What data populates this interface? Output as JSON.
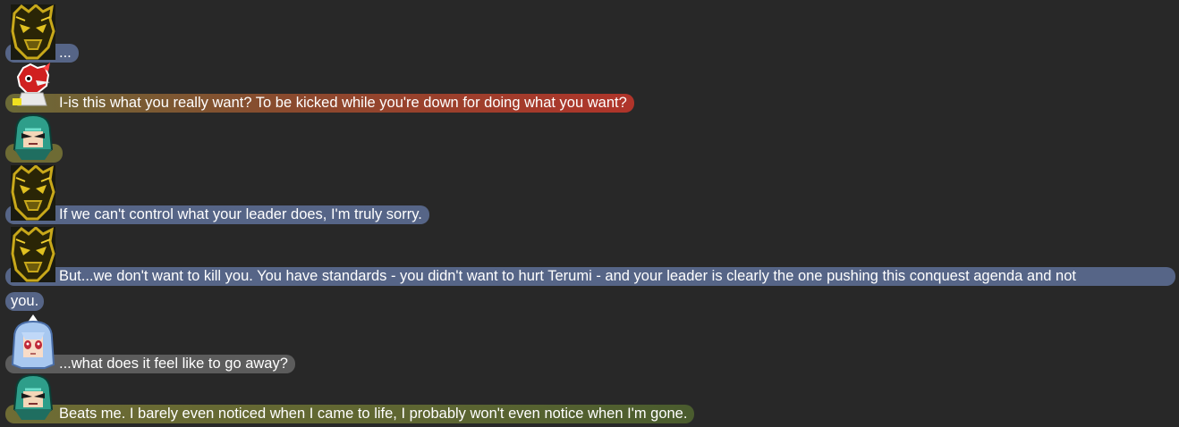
{
  "messages": [
    {
      "speaker_icon": "dark-armored-avatar-icon",
      "text": "...",
      "bubble_color": "#566587"
    },
    {
      "speaker_icon": "red-bird-avatar-icon",
      "text": "I-is this what you really want? To be kicked while you're down for doing what you want?",
      "bubble_color_start": "#6b6a37",
      "bubble_color_end": "#b0342a"
    },
    {
      "speaker_icon": "teal-helmet-avatar-icon",
      "text": "",
      "bubble_color": "#6e6b34"
    },
    {
      "speaker_icon": "dark-armored-avatar-icon",
      "text": "If we can't control what your leader does, I'm truly sorry.",
      "bubble_color": "#566587"
    },
    {
      "speaker_icon": "dark-armored-avatar-icon",
      "text_line1": "But...we don't want to kill you. You have standards - you didn't want to hurt Terumi - and your leader is clearly the one pushing this conquest agenda and not",
      "text_line2": "you.",
      "bubble_color": "#566587"
    },
    {
      "speaker_icon": "blue-hair-girl-avatar-icon",
      "text": "...what does it feel like to go away?",
      "bubble_color": "#5c5c5c"
    },
    {
      "speaker_icon": "teal-helmet-avatar-icon",
      "text": "Beats me. I barely even noticed when I came to life, I probably won't even notice when I'm gone.",
      "bubble_color_start": "#6f6c34",
      "bubble_color_end": "#4a5c2e"
    }
  ]
}
